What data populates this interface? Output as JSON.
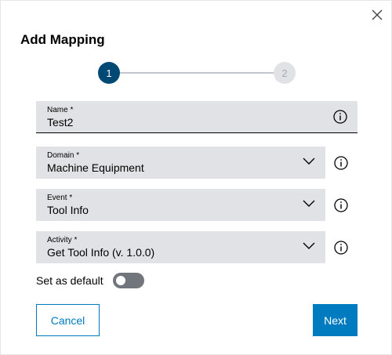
{
  "dialog": {
    "title": "Add Mapping",
    "close_icon": "close-icon"
  },
  "stepper": {
    "steps": [
      "1",
      "2"
    ],
    "active_step": 1
  },
  "fields": {
    "name": {
      "label": "Name *",
      "value": "Test2",
      "icon": "info-icon"
    },
    "domain": {
      "label": "Domain *",
      "value": "Machine Equipment",
      "icon": "chevron-down-icon"
    },
    "event": {
      "label": "Event *",
      "value": "Tool Info",
      "icon": "chevron-down-icon"
    },
    "activity": {
      "label": "Activity *",
      "value": "Get Tool Info (v. 1.0.0)",
      "icon": "chevron-down-icon"
    }
  },
  "default_toggle": {
    "label": "Set as default",
    "checked": false
  },
  "buttons": {
    "cancel": "Cancel",
    "next": "Next"
  },
  "colors": {
    "primary": "#007bc0",
    "step_active": "#004975",
    "field_bg": "#e0e2e5",
    "toggle_off": "#71767c"
  }
}
